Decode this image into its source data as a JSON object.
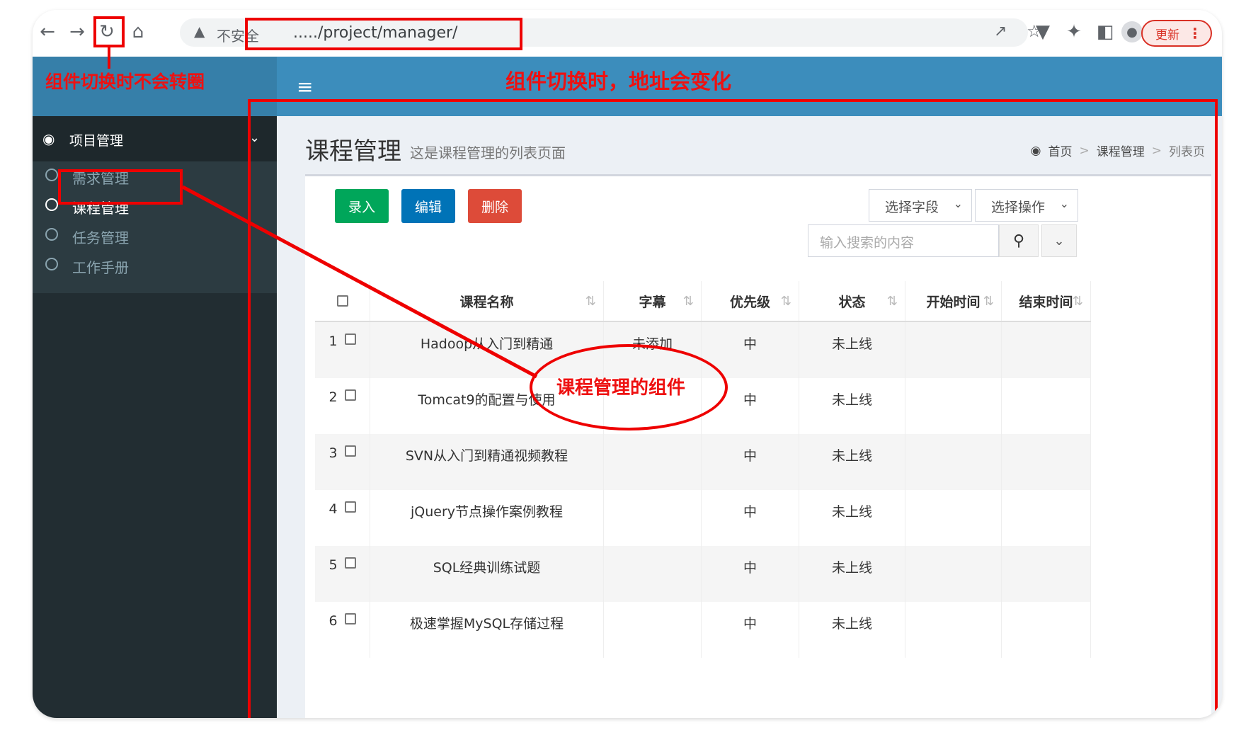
{
  "browser": {
    "security_label": "不安全",
    "url": "...../project/manager/",
    "update_label": "更新"
  },
  "sidebar": {
    "menu_title": "项目管理",
    "items": [
      {
        "label": "需求管理",
        "active": false
      },
      {
        "label": "课程管理",
        "active": true
      },
      {
        "label": "任务管理",
        "active": false
      },
      {
        "label": "工作手册",
        "active": false
      }
    ]
  },
  "page": {
    "title": "课程管理",
    "subtitle": "这是课程管理的列表页面",
    "breadcrumb": [
      "首页",
      "课程管理",
      "列表页"
    ]
  },
  "toolbar": {
    "add_label": "录入",
    "edit_label": "编辑",
    "delete_label": "删除",
    "field_select": "选择字段",
    "action_select": "选择操作",
    "search_placeholder": "输入搜索的内容"
  },
  "table": {
    "columns": [
      "课程名称",
      "字幕",
      "优先级",
      "状态",
      "开始时间",
      "结束时间"
    ],
    "rows": [
      {
        "num": "1",
        "name": "Hadoop从入门到精通",
        "subtitle": "未添加",
        "priority": "中",
        "status": "未上线",
        "start": "",
        "end": ""
      },
      {
        "num": "2",
        "name": "Tomcat9的配置与使用",
        "subtitle": "",
        "priority": "中",
        "status": "未上线",
        "start": "",
        "end": ""
      },
      {
        "num": "3",
        "name": "SVN从入门到精通视频教程",
        "subtitle": "",
        "priority": "中",
        "status": "未上线",
        "start": "",
        "end": ""
      },
      {
        "num": "4",
        "name": "jQuery节点操作案例教程",
        "subtitle": "",
        "priority": "中",
        "status": "未上线",
        "start": "",
        "end": ""
      },
      {
        "num": "5",
        "name": "SQL经典训练试题",
        "subtitle": "",
        "priority": "中",
        "status": "未上线",
        "start": "",
        "end": ""
      },
      {
        "num": "6",
        "name": "极速掌握MySQL存储过程",
        "subtitle": "",
        "priority": "中",
        "status": "未上线",
        "start": "",
        "end": ""
      }
    ]
  },
  "annotations": {
    "no_spin": "组件切换时不会转圈",
    "url_changes": "组件切换时，地址会变化",
    "component": "课程管理的组件"
  },
  "colors": {
    "annotation": "#ee0000",
    "header": "#3c8dbc",
    "sidebar": "#222d32",
    "add": "#00a65a",
    "edit": "#0073b7",
    "delete": "#dd4b39"
  }
}
